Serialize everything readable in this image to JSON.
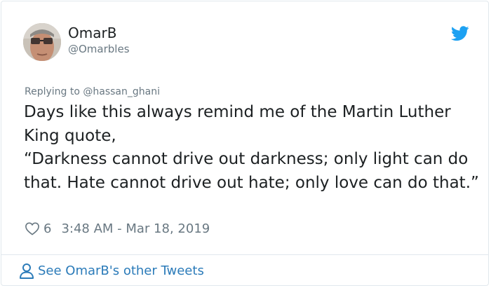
{
  "author": {
    "name": "OmarB",
    "handle": "@Omarbles"
  },
  "tweet": {
    "replying_to": "Replying to @hassan_ghani",
    "text": "Days like this always remind me of the Martin Luther King quote,\n“Darkness cannot drive out darkness; only light can do that. Hate cannot drive out hate; only love can do that.”",
    "likes": "6",
    "timestamp": "3:48 AM - Mar 18, 2019"
  },
  "footer": {
    "link_label": "See OmarB's other Tweets"
  },
  "colors": {
    "twitter_blue": "#1da1f2",
    "link_blue": "#2b7bb9",
    "muted_gray": "#697882",
    "text_dark": "#1c2022",
    "border": "#e1e8ed"
  },
  "icons": {
    "brand": "twitter-bird-icon",
    "like": "heart-icon",
    "profile": "person-icon"
  }
}
